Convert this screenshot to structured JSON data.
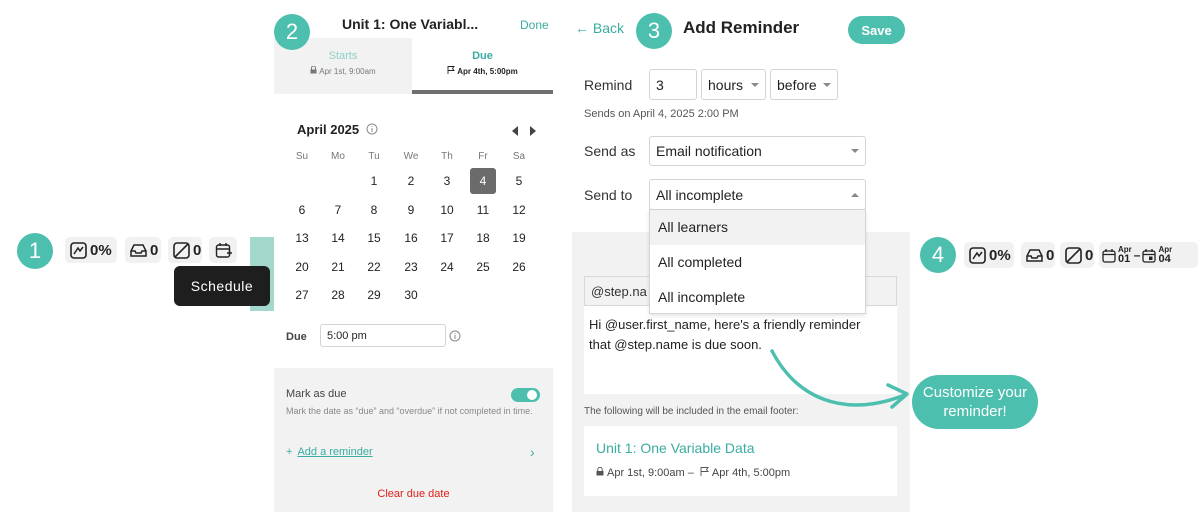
{
  "steps": {
    "one": "1",
    "two": "2",
    "three": "3",
    "four": "4"
  },
  "toolbar1": {
    "progress": "0%",
    "inbox_count": "0",
    "late_count": "0",
    "tooltip": "Schedule"
  },
  "toolbar4": {
    "progress": "0%",
    "inbox_count": "0",
    "late_count": "0",
    "start_month": "Apr",
    "start_day": "01",
    "dash": "–",
    "due_month": "Apr",
    "due_day": "04"
  },
  "schedule_panel": {
    "title": "Unit 1: One Variabl...",
    "done": "Done",
    "tabs": [
      {
        "label": "Starts",
        "sub": "Apr 1st, 9:00am",
        "icon": "lock-icon"
      },
      {
        "label": "Due",
        "sub": "Apr 4th, 5:00pm",
        "icon": "flag-icon"
      }
    ],
    "month": "April 2025",
    "weekdays": [
      "Su",
      "Mo",
      "Tu",
      "We",
      "Th",
      "Fr",
      "Sa"
    ],
    "weeks": [
      [
        "",
        "",
        "1",
        "2",
        "3",
        "4",
        "5"
      ],
      [
        "6",
        "7",
        "8",
        "9",
        "10",
        "11",
        "12"
      ],
      [
        "13",
        "14",
        "15",
        "16",
        "17",
        "18",
        "19"
      ],
      [
        "20",
        "21",
        "22",
        "23",
        "24",
        "25",
        "26"
      ],
      [
        "27",
        "28",
        "29",
        "30",
        "",
        "",
        ""
      ]
    ],
    "selected_day": "4",
    "due_label": "Due",
    "due_time": "5:00 pm",
    "mark_as_due_label": "Mark as due",
    "mark_as_due_enabled": true,
    "mark_as_due_help": "Mark the date as “due” and “overdue” if not completed in time.",
    "add_reminder": "Add a reminder",
    "add_reminder_plus": "+",
    "chevron": "›",
    "clear": "Clear due date"
  },
  "reminder": {
    "back": "← Back",
    "title": "Add Reminder",
    "save": "Save",
    "remind_label": "Remind",
    "remind_value": "3",
    "unit": "hours",
    "relation": "before",
    "sends_on": "Sends on April 4, 2025 2:00 PM",
    "send_as_label": "Send as",
    "send_as_value": "Email notification",
    "send_to_label": "Send to",
    "send_to_value": "All incomplete",
    "send_to_options": [
      "All learners",
      "All completed",
      "All incomplete"
    ],
    "subject_partial": "@step.na",
    "message_line1": "Hi @user.first_name, here's a friendly reminder",
    "message_line2": "that @step.name is due soon.",
    "footer_note": "The following will be included in the email footer:",
    "footer_title": "Unit 1: One Variable Data",
    "footer_dates": "Apr 1st, 9:00am – ",
    "footer_due": "Apr 4th, 5:00pm"
  },
  "callout": {
    "line1": "Customize your",
    "line2": "reminder!"
  },
  "colors": {
    "teal": "#4dbfae",
    "teal_text": "#3aada0",
    "red": "#e0201a",
    "toggle": "#4dbfae"
  }
}
